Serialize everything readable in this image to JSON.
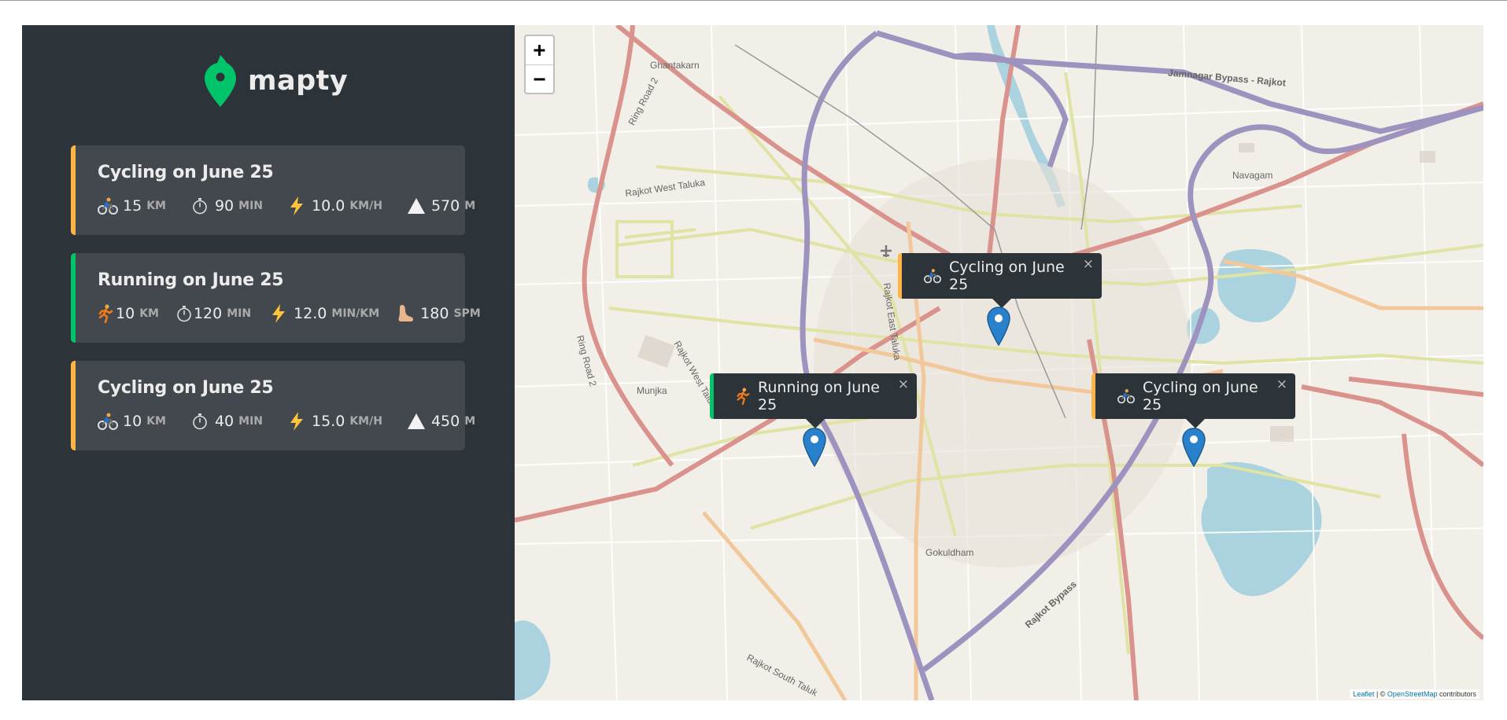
{
  "app": {
    "name": "mapty",
    "brand_color": "#00c46a"
  },
  "colors": {
    "cycling": "#ffb545",
    "running": "#00c46a",
    "sidebar_bg": "#2d3439",
    "card_bg": "#42484d"
  },
  "workouts": [
    {
      "type": "cycling",
      "title": "Cycling on June 25",
      "icon": "cyclist-icon",
      "distance": "15",
      "distance_unit": "km",
      "duration": "90",
      "duration_unit": "min",
      "speed": "10.0",
      "speed_unit": "km/h",
      "extra_icon": "mountain-icon",
      "extra": "570",
      "extra_unit": "m"
    },
    {
      "type": "running",
      "title": "Running on June 25",
      "icon": "runner-icon",
      "distance": "10",
      "distance_unit": "km",
      "duration": "120",
      "duration_unit": "min",
      "speed": "12.0",
      "speed_unit": "min/km",
      "extra_icon": "foot-icon",
      "extra": "180",
      "extra_unit": "spm"
    },
    {
      "type": "cycling",
      "title": "Cycling on June 25",
      "icon": "cyclist-icon",
      "distance": "10",
      "distance_unit": "km",
      "duration": "40",
      "duration_unit": "min",
      "speed": "15.0",
      "speed_unit": "km/h",
      "extra_icon": "mountain-icon",
      "extra": "450",
      "extra_unit": "m"
    }
  ],
  "map": {
    "zoom_in": "+",
    "zoom_out": "−",
    "popups": [
      {
        "type": "cycling",
        "label": "Cycling on June 25",
        "close": "×"
      },
      {
        "type": "running",
        "label": "Running on June 25",
        "close": "×"
      },
      {
        "type": "cycling",
        "label": "Cycling on June 25",
        "close": "×"
      }
    ],
    "place_labels": [
      "Ghantakarn",
      "Jamnagar Bypass - Rajkot",
      "Rajkot West Taluka",
      "Navagam",
      "Ring Road 2",
      "Ring Road 2",
      "Rajkot East Taluka",
      "Rajkot West Taluka",
      "Munjka",
      "Gokuldham",
      "Rajkot Bypass",
      "Rajkot South Taluk"
    ],
    "attribution": {
      "leaflet": "Leaflet",
      "sep": " | © ",
      "osm": "OpenStreetMap",
      "suffix": " contributors"
    }
  }
}
